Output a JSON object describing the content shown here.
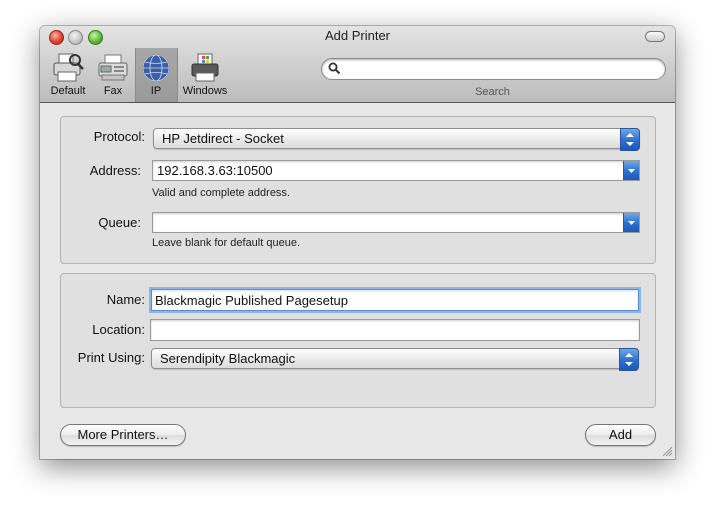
{
  "window": {
    "title": "Add Printer"
  },
  "toolbar": {
    "items": [
      {
        "label": "Default",
        "icon": "printer-search-icon"
      },
      {
        "label": "Fax",
        "icon": "fax-icon"
      },
      {
        "label": "IP",
        "icon": "globe-icon",
        "selected": true
      },
      {
        "label": "Windows",
        "icon": "windows-printer-icon"
      }
    ],
    "search": {
      "placeholder": "",
      "value": "",
      "label": "Search"
    }
  },
  "connection": {
    "protocol": {
      "label": "Protocol:",
      "value": "HP Jetdirect - Socket"
    },
    "address": {
      "label": "Address:",
      "value": "192.168.3.63:10500",
      "hint": "Valid and complete address."
    },
    "queue": {
      "label": "Queue:",
      "value": "",
      "hint": "Leave blank for default queue."
    }
  },
  "details": {
    "name": {
      "label": "Name:",
      "value": "Blackmagic Published Pagesetup"
    },
    "location": {
      "label": "Location:",
      "value": ""
    },
    "print_using": {
      "label": "Print Using:",
      "value": "Serendipity Blackmagic"
    }
  },
  "buttons": {
    "more_printers": "More Printers…",
    "add": "Add"
  },
  "colors": {
    "accent": "#2d6fd0",
    "window_bg": "#e8e8e8",
    "focus_ring": "#8cb4ea"
  }
}
